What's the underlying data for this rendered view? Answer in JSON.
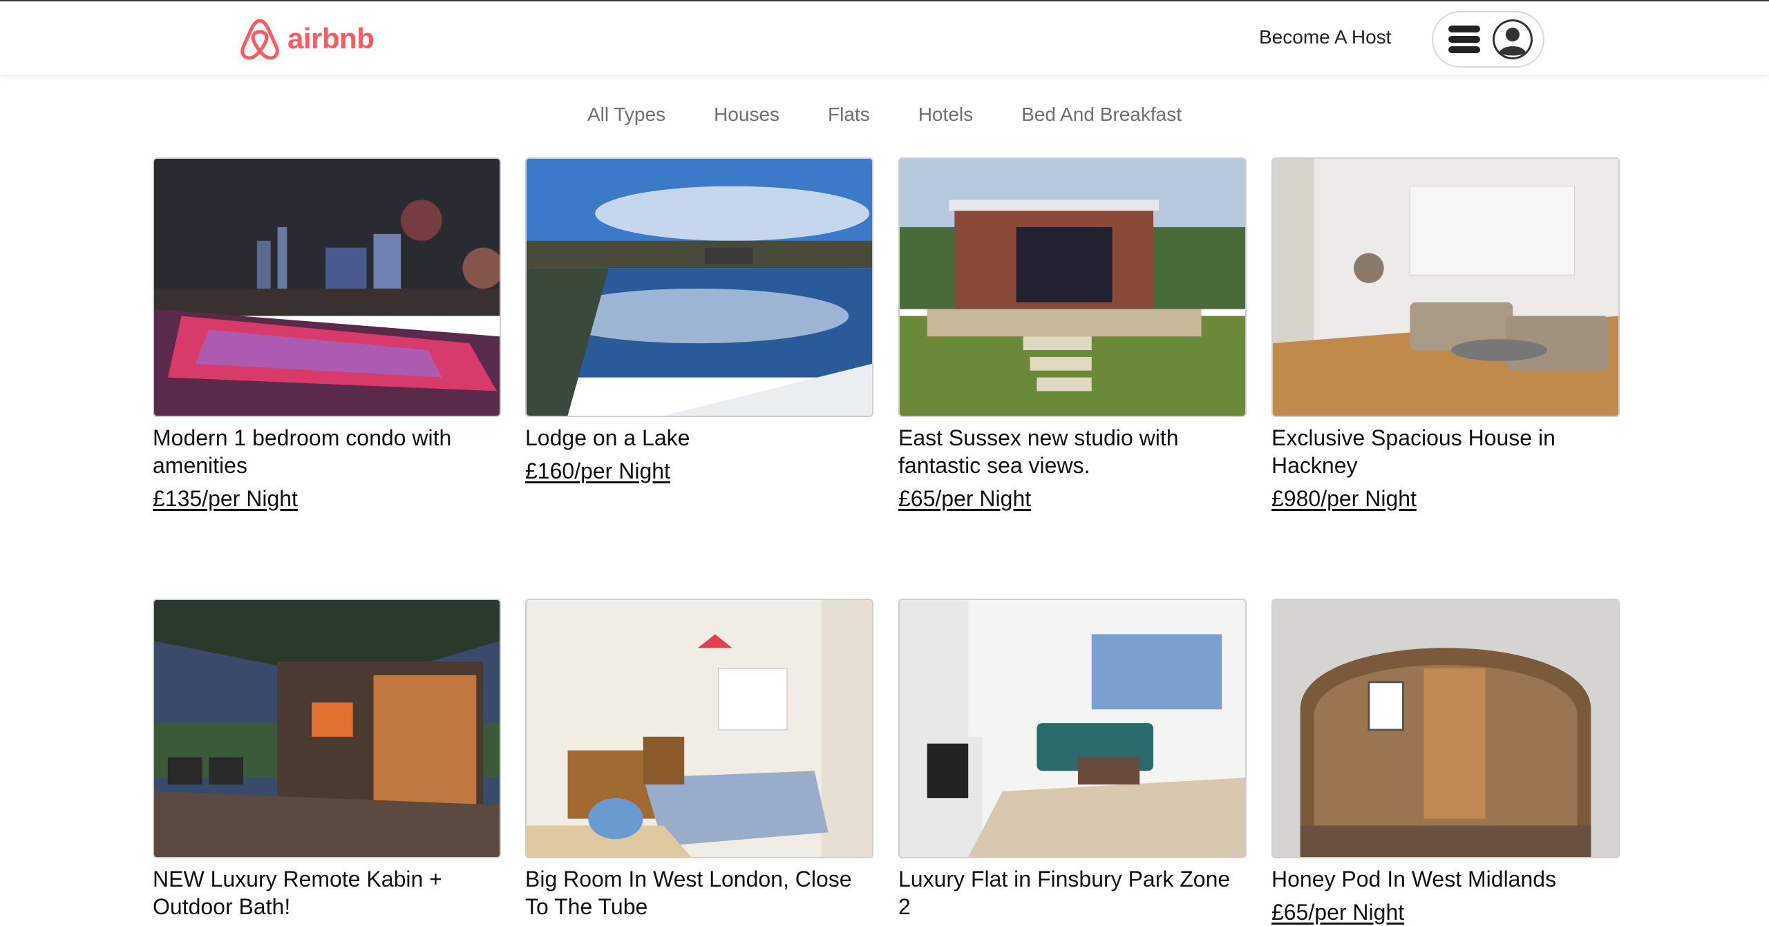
{
  "header": {
    "brand": "airbnb",
    "brand_color": "#ff5a5f",
    "logo_icon": "airbnb-belo-icon",
    "host_link": "Become A Host",
    "menu_icon": "hamburger-icon",
    "avatar_icon": "user-avatar-icon"
  },
  "filters": [
    "All Types",
    "Houses",
    "Flats",
    "Hotels",
    "Bed And Breakfast"
  ],
  "listings": [
    {
      "title": "Modern 1 bedroom condo with amenities",
      "price": "£135/per Night"
    },
    {
      "title": "Lodge on a Lake",
      "price": "£160/per Night"
    },
    {
      "title": "East Sussex new studio with fantastic sea views.",
      "price": "£65/per Night"
    },
    {
      "title": "Exclusive Spacious House in Hackney",
      "price": "£980/per Night"
    },
    {
      "title": "NEW Luxury Remote Kabin + Outdoor Bath!",
      "price": ""
    },
    {
      "title": "Big Room In West London, Close To The Tube",
      "price": ""
    },
    {
      "title": "Luxury Flat in Finsbury Park Zone 2",
      "price": ""
    },
    {
      "title": "Honey Pod In West Midlands",
      "price": "£65/per Night"
    }
  ]
}
